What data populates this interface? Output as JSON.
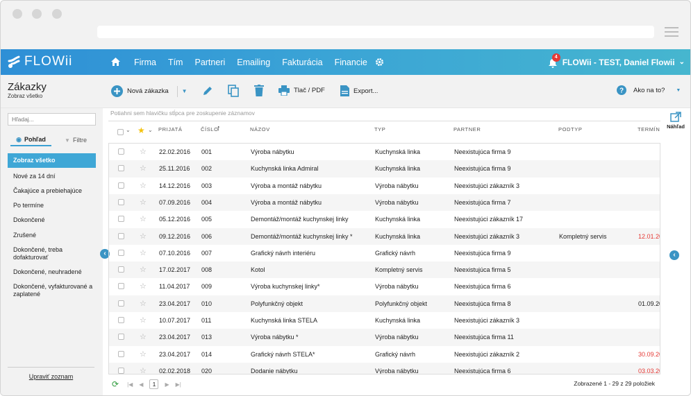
{
  "app": {
    "logo": "FLOWii"
  },
  "nav": {
    "items": [
      "Firma",
      "Tím",
      "Partneri",
      "Emailing",
      "Fakturácia",
      "Financie"
    ]
  },
  "user": {
    "notifications": "4",
    "name": "FLOWii - TEST, Daniel Flowii"
  },
  "page": {
    "title": "Zákazky",
    "subtitle": "Zobraz všetko"
  },
  "toolbar": {
    "new_order": "Nová zákazka",
    "print": "Tlač / PDF",
    "export": "Export...",
    "help": "Ako na to?"
  },
  "sidebar": {
    "search_placeholder": "Hľadaj...",
    "tab_view": "Pohľad",
    "tab_filters": "Filtre",
    "items": [
      "Zobraz všetko",
      "Nové za 14 dní",
      "Čakajúce a prebiehajúce",
      "Po termíne",
      "Dokončené",
      "Zrušené",
      "Dokončené, treba dofakturovať",
      "Dokončené, neuhradené",
      "Dokončené, vyfakturované a zaplatené"
    ],
    "edit_list": "Upraviť zoznam"
  },
  "grid": {
    "group_hint": "Potiahni sem hlavičku stĺpca pre zoskupenie záznamov",
    "columns": [
      "PRIJATÁ",
      "ČÍSLO",
      "NÁZOV",
      "TYP",
      "PARTNER",
      "PODTYP",
      "TERMÍN"
    ],
    "rows": [
      [
        "22.02.2016",
        "001",
        "Výroba nábytku",
        "Kuchynská linka",
        "Neexistujúca firma 9",
        "",
        ""
      ],
      [
        "25.11.2016",
        "002",
        "Kuchynská linka Admiral",
        "Kuchynská linka",
        "Neexistujúca firma 9",
        "",
        ""
      ],
      [
        "14.12.2016",
        "003",
        "Výroba a montáž nábytku",
        "Výroba nábytku",
        "Neexistujúci zákazník 3",
        "",
        ""
      ],
      [
        "07.09.2016",
        "004",
        "Výroba a montáž nábytku",
        "Výroba nábytku",
        "Neexistujúca firma 7",
        "",
        ""
      ],
      [
        "05.12.2016",
        "005",
        "Demontáž/montáž kuchynskej linky",
        "Kuchynská linka",
        "Neexistujúci zákazník 17",
        "",
        ""
      ],
      [
        "09.12.2016",
        "006",
        "Demontáž/montáž kuchynskej linky *",
        "Kuchynská linka",
        "Neexistujúci zákazník 3",
        "Kompletný servis",
        "12.01.20"
      ],
      [
        "07.10.2016",
        "007",
        "Grafický návrh interiéru",
        "Grafický návrh",
        "Neexistujúca firma 9",
        "",
        ""
      ],
      [
        "17.02.2017",
        "008",
        "Kotol",
        "Kompletný servis",
        "Neexistujúca firma 5",
        "",
        ""
      ],
      [
        "11.04.2017",
        "009",
        "Výroba kuchynskej linky*",
        "Výroba nábytku",
        "Neexistujúca firma 6",
        "",
        ""
      ],
      [
        "23.04.2017",
        "010",
        "Polyfunkčný objekt",
        "Polyfunkčný objekt",
        "Neexistujúca firma 8",
        "",
        "01.09.20"
      ],
      [
        "10.07.2017",
        "011",
        "Kuchynská linka STELA",
        "Kuchynská linka",
        "Neexistujúci zákazník 3",
        "",
        ""
      ],
      [
        "23.04.2017",
        "013",
        "Výroba nábytku *",
        "Výroba nábytku",
        "Neexistujúca firma 11",
        "",
        ""
      ],
      [
        "23.04.2017",
        "014",
        "Grafický návrh STELA*",
        "Grafický návrh",
        "Neexistujúci zákazník 2",
        "",
        "30.09.20"
      ],
      [
        "02.02.2018",
        "020",
        "Dodanie nábytku",
        "Výroba nábytku",
        "Neexistujúca firma 6",
        "",
        "03.03.20"
      ]
    ],
    "overdue_rows": [
      5,
      12,
      13
    ]
  },
  "pager": {
    "page": "1",
    "info": "Zobrazené 1 - 29 z 29 položiek"
  },
  "preview": {
    "label": "Náhľad"
  },
  "colors": {
    "accent": "#3aa0d3",
    "overdue": "#e53935"
  }
}
